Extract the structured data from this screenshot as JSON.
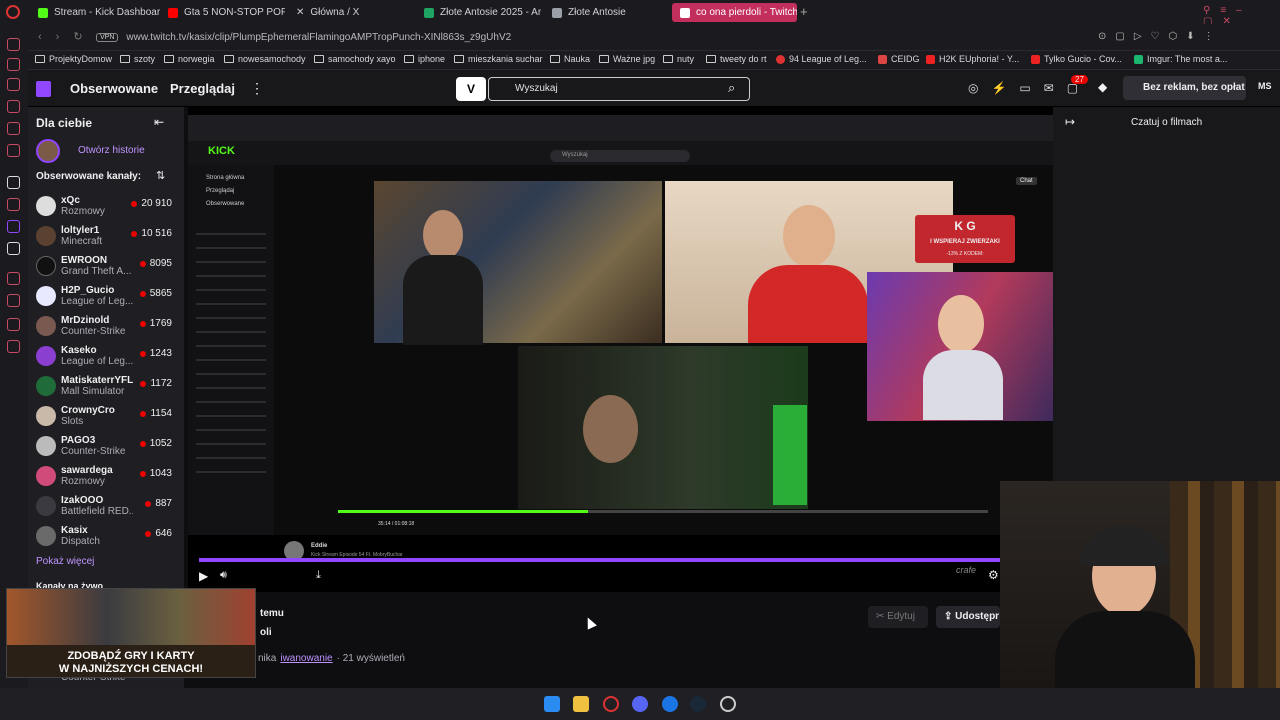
{
  "browser": {
    "tabs": [
      {
        "label": "Stream - Kick Dashboard",
        "color": "#53fc18"
      },
      {
        "label": "Gta 5 NON-STOP POP ra",
        "color": "#ff0000"
      },
      {
        "label": "Główna / X",
        "color": "#ffffff"
      },
      {
        "label": "Złote Antosie 2025 - Ark",
        "color": "#1fa463"
      },
      {
        "label": "Złote Antosie",
        "color": "#9aa0a6"
      },
      {
        "label": "co ona pierdoli - Twitch",
        "color": "#9146ff"
      }
    ],
    "vpn_label": "VPN",
    "url": "www.twitch.tv/kasix/clip/PlumpEphemeralFlamingoAMPTropPunch-XINl863s_z9gUhV2",
    "bookmarks": [
      "ProjektyDomow",
      "szoty",
      "norwegia",
      "nowesamochody",
      "samochody xayo",
      "iphone",
      "mieszkania suchar",
      "Nauka",
      "Ważne jpg",
      "nuty",
      "tweety do rt",
      "94 League of Leg...",
      "CEIDG",
      "H2K EUphoria! - Y...",
      "Tylko Gucio - Cov...",
      "Imgur: The most a..."
    ]
  },
  "twitch": {
    "nav": {
      "following": "Obserwowane",
      "browse": "Przeglądaj"
    },
    "search_placeholder": "Wyszukaj",
    "notif_count": "27",
    "adfree": "Bez reklam, bez opłat",
    "avatar_initials": "MS"
  },
  "sidebar": {
    "header": "Dla ciebie",
    "history": "Otwórz historie",
    "followed_label": "Obserwowane kanały:",
    "channels": [
      {
        "name": "xQc",
        "game": "Rozmowy",
        "viewers": "20 910"
      },
      {
        "name": "loltyler1",
        "game": "Minecraft",
        "viewers": "10 516"
      },
      {
        "name": "EWROON",
        "game": "Grand Theft A...",
        "viewers": "8095"
      },
      {
        "name": "H2P_Gucio",
        "game": "League of Leg...",
        "viewers": "5865"
      },
      {
        "name": "MrDzinold",
        "game": "Counter-Strike",
        "viewers": "1769"
      },
      {
        "name": "Kaseko",
        "game": "League of Leg...",
        "viewers": "1243"
      },
      {
        "name": "MatiskaterrYFL",
        "game": "Mall Simulator",
        "viewers": "1172"
      },
      {
        "name": "CrownyCro",
        "game": "Slots",
        "viewers": "1154"
      },
      {
        "name": "PAGO3",
        "game": "Counter-Strike",
        "viewers": "1052"
      },
      {
        "name": "sawardega",
        "game": "Rozmowy",
        "viewers": "1043"
      },
      {
        "name": "IzakOOO",
        "game": "Battlefield RED...",
        "viewers": "887"
      },
      {
        "name": "Kasix",
        "game": "Dispatch",
        "viewers": "646"
      }
    ],
    "show_more": "Pokaż więcej",
    "live_label": "Kanały na żywo",
    "bottom_game": "Counter-Strike"
  },
  "kick": {
    "logo": "KICK",
    "search": "Wyszukaj",
    "nav": [
      "Strona główna",
      "Przeglądaj",
      "Obserwowane"
    ],
    "chat_btn": "Chat",
    "streamer": "Eddie",
    "title": "Kick Stream Episode 54 Ft. MobryBuchar",
    "time": "35:14 / 01:08:18"
  },
  "overlay": {
    "line1": "K G",
    "line2": "I WSPIERAJ ZWIERZAKI",
    "line3": "-13% Z KODEM:"
  },
  "clip": {
    "time_ago": "temu",
    "title_frag": "oli",
    "meta_prefix": "nika",
    "clipper": "iwanowanie",
    "views": "· 21 wyświetleń",
    "edit": "Edytuj",
    "share": "Udostępr",
    "watermark": "crafe"
  },
  "chat": {
    "header": "Czatuj o filmach"
  },
  "ad": {
    "line1": "ZDOBĄDŹ GRY I KARTY",
    "line2": "W NAJNIŻSZYCH CENACH!"
  },
  "colors": {
    "twitch_purple": "#9146ff",
    "kick_green": "#53fc18",
    "live_red": "#eb0400",
    "active_tab": "#c32f5d"
  }
}
